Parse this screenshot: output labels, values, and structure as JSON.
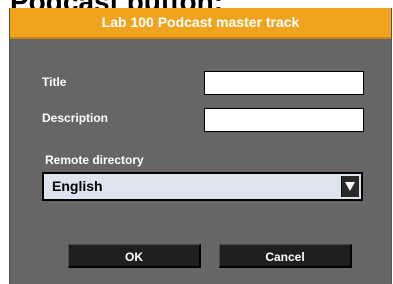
{
  "page": {
    "heading": "Podcast button:"
  },
  "dialog": {
    "title": "Lab 100 Podcast master track",
    "fields": {
      "title_label": "Title",
      "title_value": "",
      "description_label": "Description",
      "description_value": ""
    },
    "remote_directory": {
      "label": "Remote directory",
      "selected": "English"
    },
    "buttons": {
      "ok": "OK",
      "cancel": "Cancel"
    }
  },
  "colors": {
    "titlebar": "#f0a41e",
    "dialog_background": "#666666",
    "button_background": "#1f1f1f",
    "dropdown_background": "#dde4ef"
  },
  "icons": {
    "dropdown_arrow": "triangle-down-icon"
  }
}
